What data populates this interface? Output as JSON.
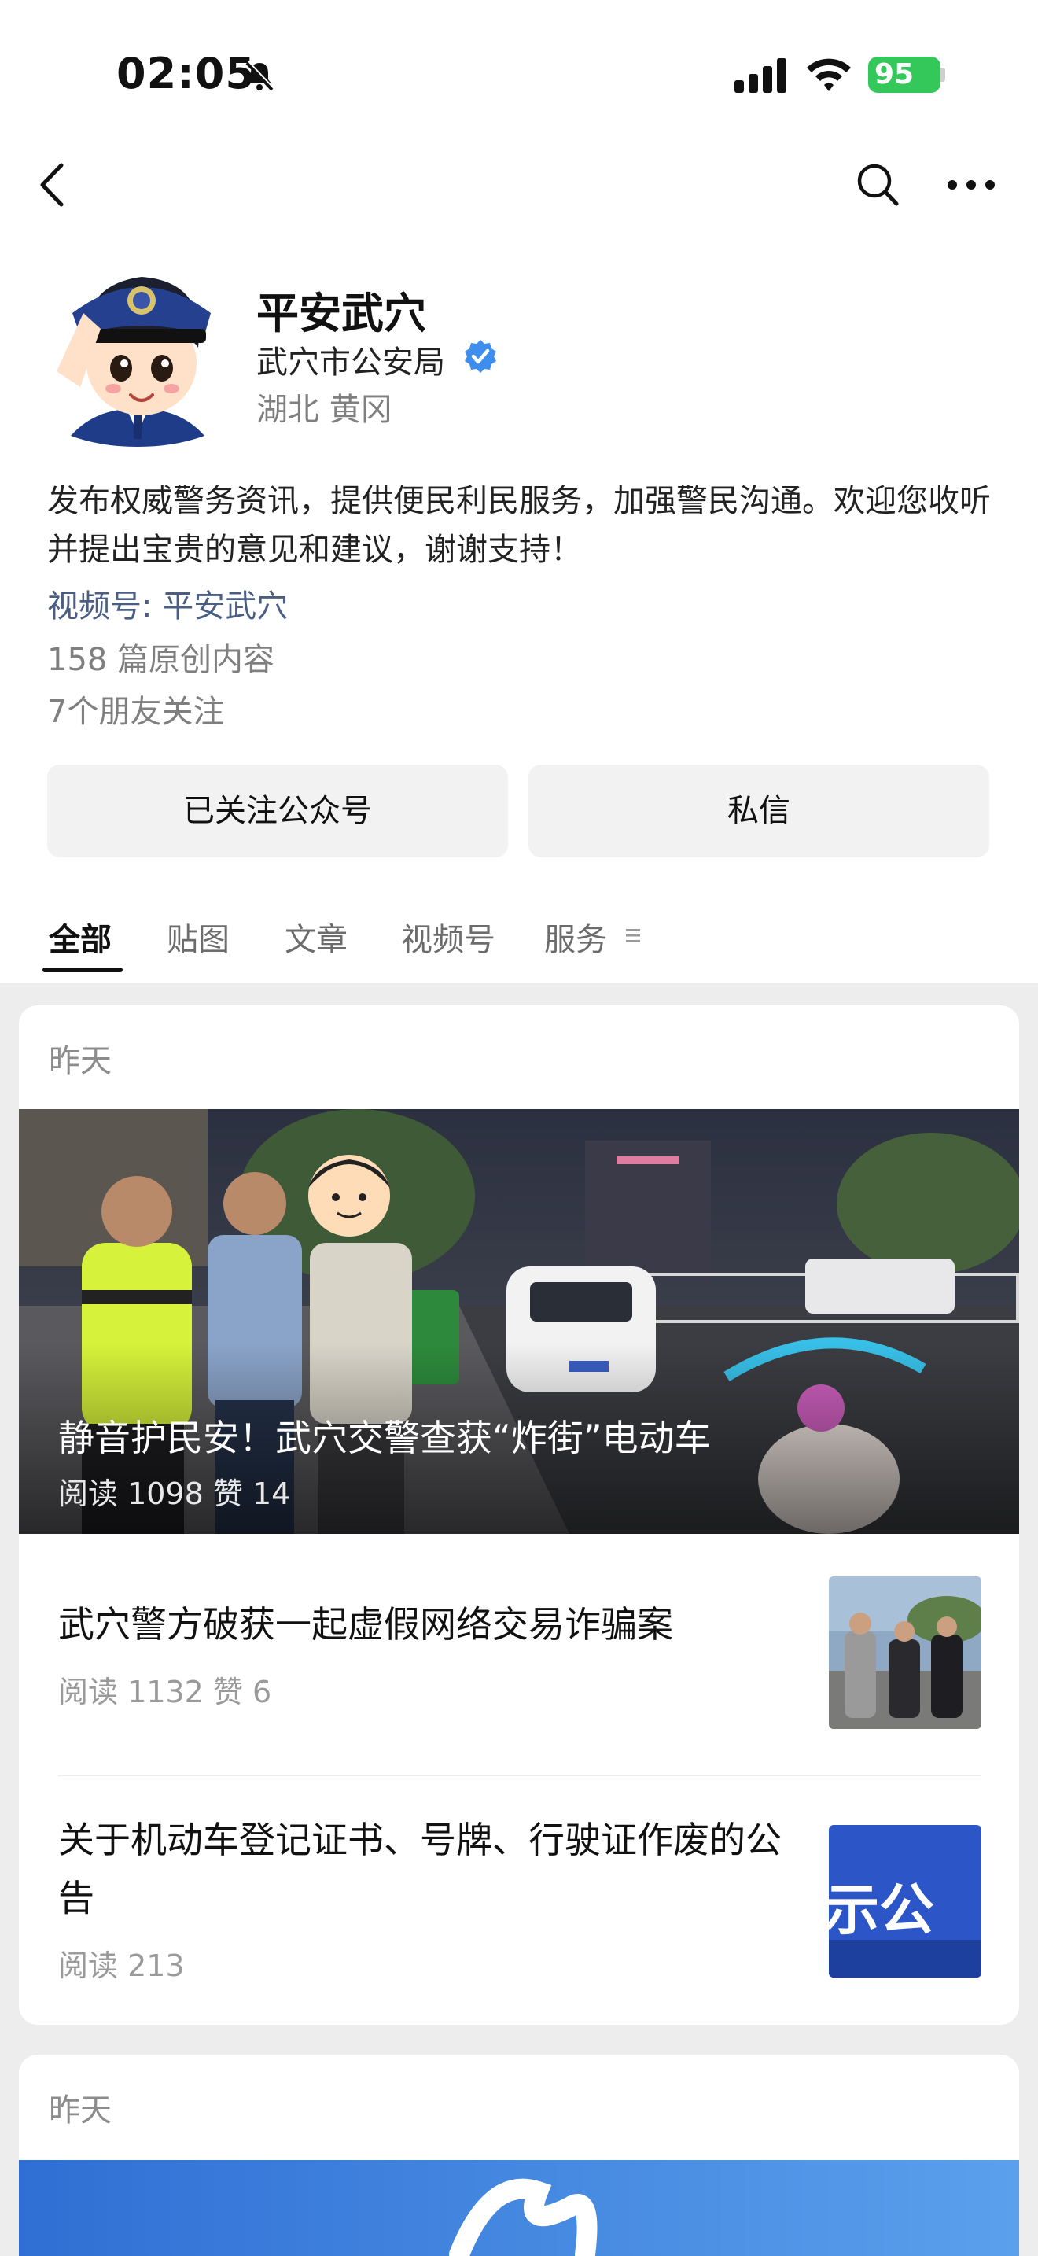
{
  "status": {
    "time": "02:05",
    "battery": "95"
  },
  "profile": {
    "name": "平安武穴",
    "org": "武穴市公安局",
    "location": "湖北 黄冈",
    "description": "发布权威警务资讯，提供便民利民服务，加强警民沟通。欢迎您收听并提出宝贵的意见和建议，谢谢支持！",
    "channel": "视频号: 平安武穴",
    "original_count": "158 篇原创内容",
    "friends": "7个朋友关注"
  },
  "buttons": {
    "follow": "已关注公众号",
    "message": "私信"
  },
  "tabs": [
    {
      "label": "全部"
    },
    {
      "label": "贴图"
    },
    {
      "label": "文章"
    },
    {
      "label": "视频号"
    },
    {
      "label": "服务"
    }
  ],
  "feed": [
    {
      "date": "昨天",
      "hero": {
        "title": "静音护民安！武穴交警查获“炸街”电动车",
        "meta": "阅读 1098   赞 14"
      },
      "articles": [
        {
          "title": "武穴警方破获一起虚假网络交易诈骗案",
          "meta": "阅读 1132   赞 6"
        },
        {
          "title": "关于机动车登记证书、号牌、行驶证作废的公告",
          "meta": "阅读 213",
          "thumb_text": "示公"
        }
      ]
    },
    {
      "date": "昨天"
    }
  ],
  "colors": {
    "accent_link": "#4a5e84",
    "verified": "#3e8ef0",
    "battery": "#34c759"
  }
}
